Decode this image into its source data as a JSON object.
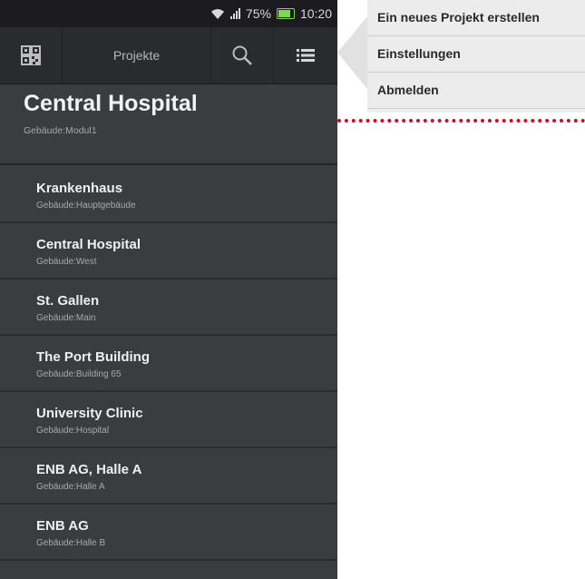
{
  "statusbar": {
    "battery": "75%",
    "time": "10:20"
  },
  "actionbar": {
    "title": "Projekte"
  },
  "current_project": {
    "title": "Central Hospital",
    "subtitle": "Gebäude:Modul1"
  },
  "projects": [
    {
      "title": "Krankenhaus",
      "subtitle": "Gebäude:Hauptgebäude"
    },
    {
      "title": "Central Hospital",
      "subtitle": "Gebäude:West"
    },
    {
      "title": "St. Gallen",
      "subtitle": "Gebäude:Main"
    },
    {
      "title": "The Port Building",
      "subtitle": "Gebäude:Building 65"
    },
    {
      "title": "University Clinic",
      "subtitle": "Gebäude:Hospital"
    },
    {
      "title": "ENB AG, Halle A",
      "subtitle": "Gebäude:Halle A"
    },
    {
      "title": "ENB AG",
      "subtitle": "Gebäude:Halle B"
    }
  ],
  "menu": {
    "items": [
      {
        "label": "Ein neues Projekt erstellen"
      },
      {
        "label": "Einstellungen"
      },
      {
        "label": "Abmelden"
      }
    ]
  },
  "colors": {
    "battery": "#7bd84f",
    "divider": "#c8102e"
  },
  "icons": [
    "wifi-icon",
    "signal-icon",
    "battery-icon",
    "qr-code-icon",
    "search-icon",
    "menu-icon"
  ]
}
